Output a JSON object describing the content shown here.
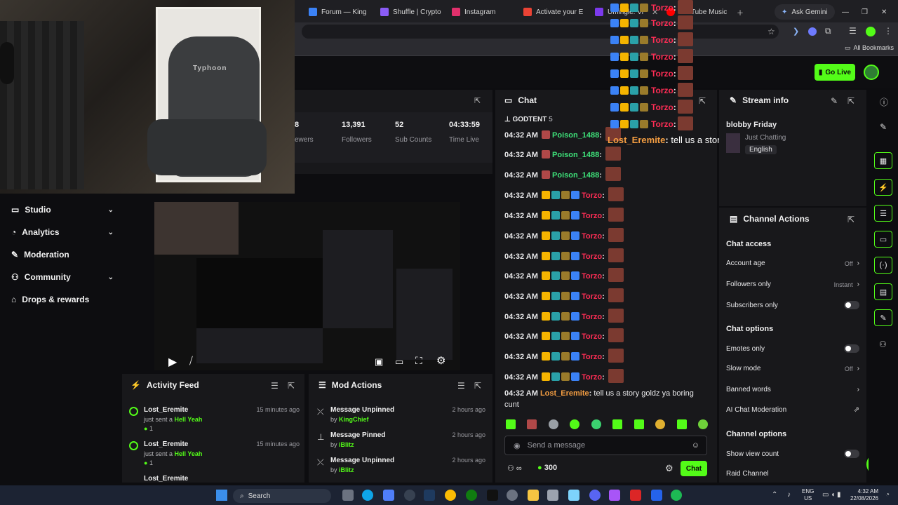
{
  "browser": {
    "tabs": [
      "Forum — King",
      "Shuffle | Crypto",
      "Instagram",
      "Activate your E",
      "Umingle: Vi",
      "YouTube Music"
    ],
    "ask_gemini": "Ask Gemini",
    "bookmarks": "All Bookmarks"
  },
  "header": {
    "go_live": "Go Live"
  },
  "webcam": {
    "chair_brand": "Typhoon"
  },
  "nav": {
    "items": [
      {
        "label": "Studio",
        "chevron": true
      },
      {
        "label": "Analytics",
        "chevron": true
      },
      {
        "label": "Moderation",
        "chevron": false
      },
      {
        "label": "Community",
        "chevron": true
      },
      {
        "label": "Drops & rewards",
        "chevron": false
      }
    ]
  },
  "stats": {
    "partial_value": "8",
    "partial_label": "ewers",
    "followers_value": "13,391",
    "followers_label": "Followers",
    "subs_value": "52",
    "subs_label": "Sub Counts",
    "time_value": "04:33:59",
    "time_label": "Time Live"
  },
  "activity": {
    "title": "Activity Feed",
    "items": [
      {
        "user": "Lost_Eremite",
        "action": "just sent a",
        "item": "Hell Yeah",
        "count": "1",
        "time": "15 minutes ago"
      },
      {
        "user": "Lost_Eremite",
        "action": "just sent a",
        "item": "Hell Yeah",
        "count": "1",
        "time": "15 minutes ago"
      },
      {
        "user": "Lost_Eremite",
        "action": "",
        "item": "",
        "count": "",
        "time": ""
      }
    ]
  },
  "mod": {
    "title": "Mod Actions",
    "items": [
      {
        "action": "Message Unpinned",
        "by": "by",
        "user": "KingChief",
        "time": "2 hours ago"
      },
      {
        "action": "Message Pinned",
        "by": "by",
        "user": "iBlitz",
        "time": "2 hours ago"
      },
      {
        "action": "Message Unpinned",
        "by": "by",
        "user": "iBlitz",
        "time": "2 hours ago"
      }
    ]
  },
  "chat": {
    "title": "Chat",
    "pinned_user": "GODTENT",
    "pinned_count": "5",
    "lines": [
      {
        "time": "04:32 AM",
        "user": "Poison_1488",
        "color": "#3ee27a"
      },
      {
        "time": "04:32 AM",
        "user": "Poison_1488",
        "color": "#3ee27a"
      },
      {
        "time": "04:32 AM",
        "user": "Poison_1488",
        "color": "#3ee27a"
      },
      {
        "time": "04:32 AM",
        "user": "Torzo",
        "color": "#ff2d55"
      },
      {
        "time": "04:32 AM",
        "user": "Torzo",
        "color": "#ff2d55"
      },
      {
        "time": "04:32 AM",
        "user": "Torzo",
        "color": "#ff2d55"
      },
      {
        "time": "04:32 AM",
        "user": "Torzo",
        "color": "#ff2d55"
      },
      {
        "time": "04:32 AM",
        "user": "Torzo",
        "color": "#ff2d55"
      },
      {
        "time": "04:32 AM",
        "user": "Torzo",
        "color": "#ff2d55"
      },
      {
        "time": "04:32 AM",
        "user": "Torzo",
        "color": "#ff2d55"
      },
      {
        "time": "04:32 AM",
        "user": "Torzo",
        "color": "#ff2d55"
      },
      {
        "time": "04:32 AM",
        "user": "Torzo",
        "color": "#ff2d55"
      },
      {
        "time": "04:32 AM",
        "user": "Torzo",
        "color": "#ff2d55"
      }
    ],
    "last_time": "04:32 AM",
    "last_user": "Lost_Eremite",
    "last_msg": "tell us a story goldz ya boring",
    "last_msg2": "cunt",
    "placeholder": "Send a message",
    "points": "300",
    "send": "Chat"
  },
  "overlay": {
    "user": "Torzo",
    "colon": ":",
    "popup_user": "Lost_Eremite",
    "popup_msg": "tell us a story goldz ya boring cunt"
  },
  "stream_info": {
    "title": "Stream info",
    "stream_title": "blobby Friday",
    "category": "Just Chatting",
    "language": "English"
  },
  "channel_actions": {
    "title": "Channel Actions",
    "chat_access": "Chat access",
    "account_age": "Account age",
    "account_age_val": "Off",
    "followers_only": "Followers only",
    "followers_only_val": "Instant",
    "subscribers_only": "Subscribers only",
    "chat_options": "Chat options",
    "emotes_only": "Emotes only",
    "slow_mode": "Slow mode",
    "slow_mode_val": "Off",
    "banned_words": "Banned words",
    "ai_mod": "AI Chat Moderation",
    "channel_options": "Channel options",
    "show_view_count": "Show view count",
    "raid_channel": "Raid Channel"
  },
  "taskbar": {
    "search": "Search",
    "lang1": "ENG",
    "lang2": "US",
    "time": "4:32 AM",
    "date": "22/08/2026"
  },
  "colors": {
    "accent": "#53fc18",
    "panel": "#18181b",
    "torzo": "#ff2d55"
  }
}
